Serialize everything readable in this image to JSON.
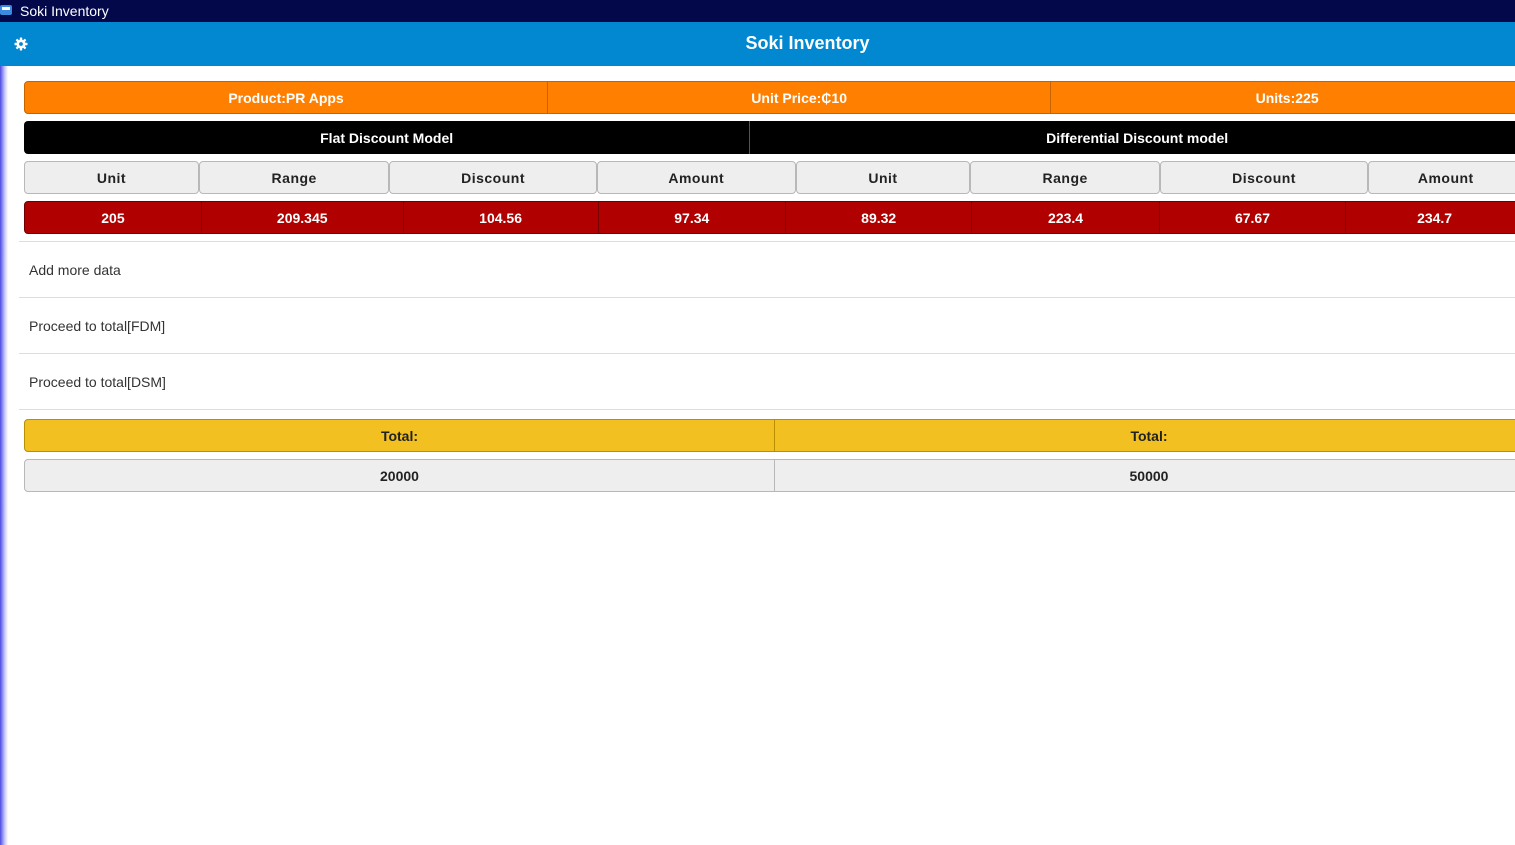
{
  "window": {
    "title": "Soki Inventory"
  },
  "header": {
    "title": "Soki Inventory",
    "settings_icon": "gear-icon"
  },
  "product_bar": {
    "product": "Product:PR Apps",
    "unit_price": "Unit Price:₵10",
    "units": "Units:225"
  },
  "models": {
    "flat": "Flat Discount Model",
    "differential": "Differential Discount model"
  },
  "columns": [
    "Unit",
    "Range",
    "Discount",
    "Amount",
    "Unit",
    "Range",
    "Discount",
    "Amount"
  ],
  "row": [
    "205",
    "209.345",
    "104.56",
    "97.34",
    "89.32",
    "223.4",
    "67.67",
    "234.7"
  ],
  "actions": [
    "Add more data",
    "Proceed to total[FDM]",
    "Proceed to total[DSM]"
  ],
  "totals": {
    "label_left": "Total:",
    "label_right": "Total:",
    "value_left": "20000",
    "value_right": "50000"
  },
  "colors": {
    "titlebar": "#02084a",
    "header": "#0288d1",
    "product_bar": "#ff8000",
    "model_bar": "#000000",
    "data_row": "#b00000",
    "totals_bar": "#f2c020"
  }
}
